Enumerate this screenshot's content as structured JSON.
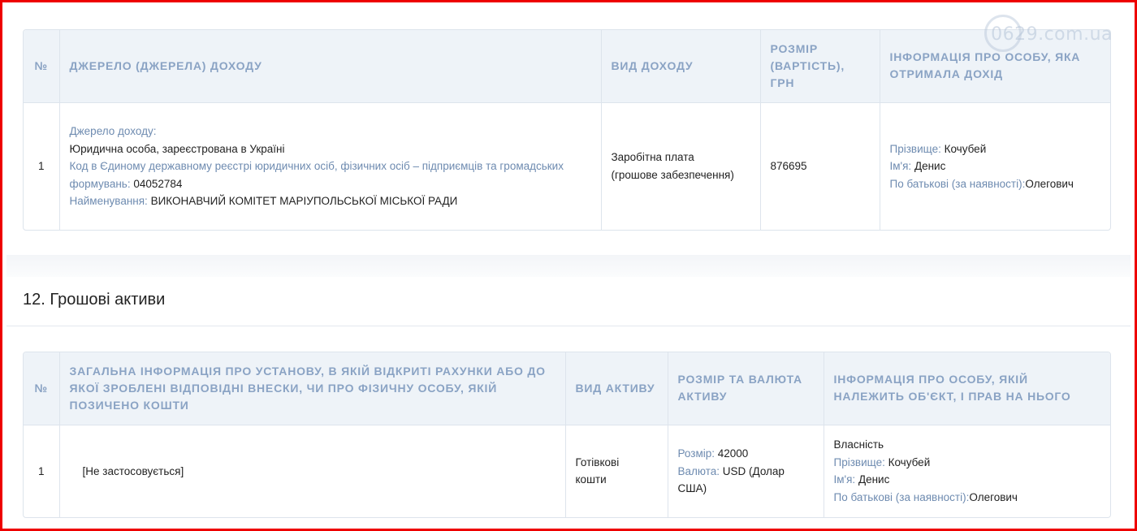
{
  "watermark": "0629.com.ua",
  "income_table": {
    "headers": [
      "№",
      "Джерело (джерела) доходу",
      "Вид доходу",
      "Розмір (вартість), грн",
      "Інформація про особу, яка отримала дохід"
    ],
    "row": {
      "num": "1",
      "source_label": "Джерело доходу:",
      "source_value": "Юридична особа, зареєстрована в Україні",
      "code_label": "Код в Єдиному державному реєстрі юридичних осіб, фізичних осіб – підприємців та громадських формувань:",
      "code_value": "04052784",
      "name_label": "Найменування:",
      "name_value": "ВИКОНАВЧИЙ КОМІТЕТ МАРІУПОЛЬСЬКОЇ МІСЬКОЇ РАДИ",
      "type_line1": "Заробітна плата",
      "type_line2": "(грошове забезпечення)",
      "amount": "876695",
      "surname_label": "Прізвище:",
      "surname_value": "Кочубей",
      "firstname_label": "Ім'я:",
      "firstname_value": "Денис",
      "patronymic_label": "По батькові (за наявності):",
      "patronymic_value": "Олегович"
    }
  },
  "section": {
    "title": "12. Грошові активи"
  },
  "assets_table": {
    "headers": [
      "№",
      "Загальна інформація про установу, в якій відкриті рахунки або до якої зроблені відповідні внески, чи про фізичну особу, якій позичено кошти",
      "Вид активу",
      "Розмір та валюта активу",
      "Інформація про особу, якій належить об'єкт, і прав на нього"
    ],
    "row": {
      "num": "1",
      "institution": "[Не застосовується]",
      "asset_type_line1": "Готівкові",
      "asset_type_line2": "кошти",
      "size_label": "Розмір:",
      "size_value": "42000",
      "currency_label": "Валюта:",
      "currency_value": "USD (Долар США)",
      "ownership": "Власність",
      "surname_label": "Прізвище:",
      "surname_value": "Кочубей",
      "firstname_label": "Ім'я:",
      "firstname_value": "Денис",
      "patronymic_label": "По батькові (за наявності):",
      "patronymic_value": "Олегович"
    }
  }
}
